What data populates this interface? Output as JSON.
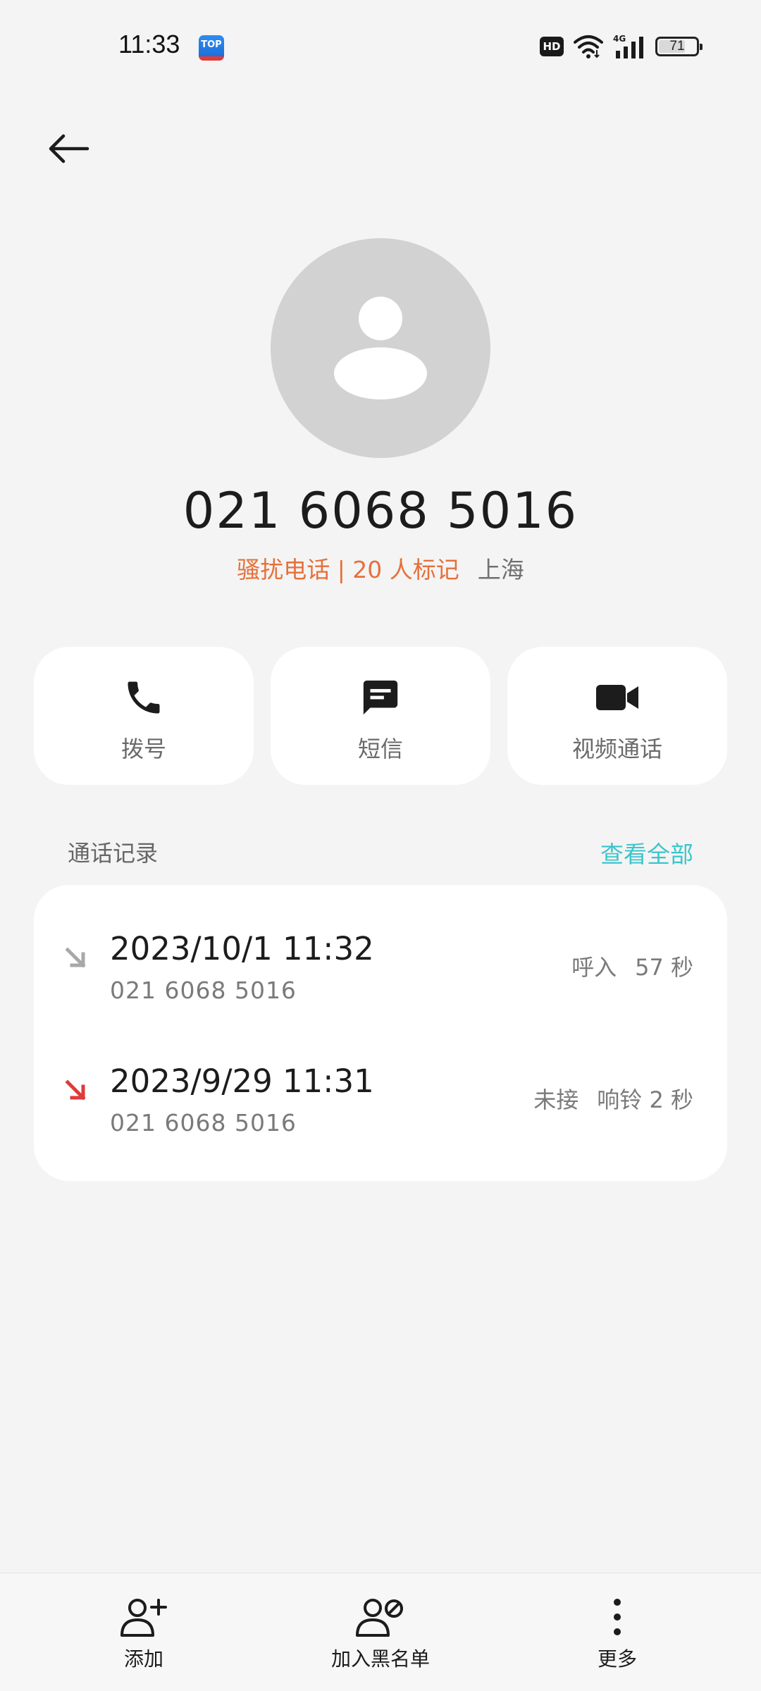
{
  "status_bar": {
    "time": "11:33",
    "app_icon_text": "TOP",
    "hd": "HD",
    "network": "4G",
    "battery": "71",
    "battery_level": 0.71
  },
  "contact": {
    "number": "021 6068 5016",
    "tag": "骚扰电话 | 20 人标记",
    "location": "上海",
    "tag_color": "#e6703a"
  },
  "actions": [
    {
      "label": "拨号",
      "icon": "phone-icon"
    },
    {
      "label": "短信",
      "icon": "message-icon"
    },
    {
      "label": "视频通话",
      "icon": "video-camera-icon"
    }
  ],
  "call_log": {
    "title": "通话记录",
    "view_all": "查看全部",
    "view_all_color": "#3cc5cc",
    "entries": [
      {
        "datetime": "2023/10/1 11:32",
        "number": "021 6068 5016",
        "type": "呼入",
        "duration": "57 秒",
        "icon": "incoming-call-arrow-icon",
        "icon_color": "#a8a8a8"
      },
      {
        "datetime": "2023/9/29 11:31",
        "number": "021 6068 5016",
        "type": "未接",
        "duration": "响铃 2 秒",
        "icon": "missed-call-arrow-icon",
        "icon_color": "#e03a3a"
      }
    ]
  },
  "bottom_bar": [
    {
      "label": "添加",
      "icon": "add-contact-icon"
    },
    {
      "label": "加入黑名单",
      "icon": "block-contact-icon"
    },
    {
      "label": "更多",
      "icon": "more-vertical-icon"
    }
  ]
}
